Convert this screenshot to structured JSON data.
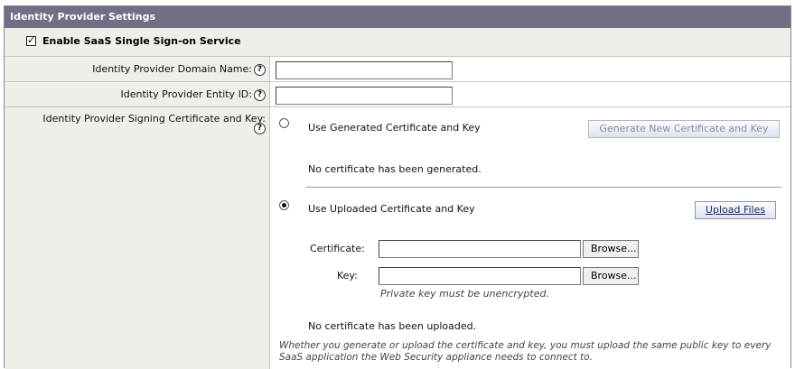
{
  "panel": {
    "title": "Identity Provider Settings"
  },
  "enable": {
    "label": "Enable SaaS Single Sign-on Service",
    "checked": true,
    "check_glyph": "✓"
  },
  "rows": {
    "domain_name": {
      "label": "Identity Provider Domain Name:",
      "help_glyph": "?",
      "value": ""
    },
    "entity_id": {
      "label": "Identity Provider Entity ID:",
      "help_glyph": "?",
      "value": ""
    },
    "signing": {
      "label": "Identity Provider Signing Certificate and Key:",
      "help_glyph": "?"
    }
  },
  "generated": {
    "option_label": "Use Generated Certificate and Key",
    "selected": false,
    "generate_button": "Generate New Certificate and Key",
    "status": "No certificate has been generated."
  },
  "uploaded": {
    "option_label": "Use Uploaded Certificate and Key",
    "selected": true,
    "upload_button": "Upload Files",
    "certificate_label": "Certificate:",
    "certificate_value": "",
    "key_label": "Key:",
    "key_value": "",
    "browse_label": "Browse...",
    "key_note": "Private key must be unencrypted.",
    "status": "No certificate has been uploaded."
  },
  "footer_note": "Whether you generate or upload the certificate and key, you must upload the same public key to every SaaS application the Web Security appliance needs to connect to."
}
